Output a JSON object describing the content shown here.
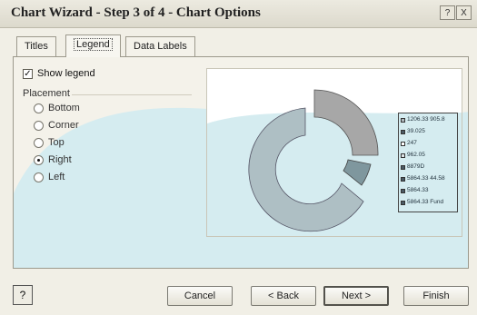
{
  "window": {
    "title": "Chart Wizard - Step 3 of 4 - Chart Options",
    "help_glyph": "?",
    "close_glyph": "X"
  },
  "tabs": [
    {
      "label": "Titles",
      "active": false
    },
    {
      "label": "Legend",
      "active": true
    },
    {
      "label": "Data Labels",
      "active": false
    }
  ],
  "legend_tab": {
    "show_legend_label": "Show legend",
    "show_legend_checked": true,
    "placement_label": "Placement",
    "placements": [
      {
        "label": "Bottom",
        "selected": false
      },
      {
        "label": "Corner",
        "selected": false
      },
      {
        "label": "Top",
        "selected": false
      },
      {
        "label": "Right",
        "selected": true
      },
      {
        "label": "Left",
        "selected": false
      }
    ]
  },
  "preview": {
    "legend_entries": [
      {
        "label": "1206.33 905.8",
        "swatch": "#aeb8bd"
      },
      {
        "label": "39.025",
        "swatch": "#4b5a64"
      },
      {
        "label": "247",
        "swatch": "#ffffff"
      },
      {
        "label": "962.05",
        "swatch": "#dde3e6"
      },
      {
        "label": "8879D",
        "swatch": "#4b5a64"
      },
      {
        "label": "5864.33 44.58",
        "swatch": "#4b5a64"
      },
      {
        "label": "5864.33",
        "swatch": "#4b5a64"
      },
      {
        "label": "5864.33 Fund",
        "swatch": "#4b5a64"
      }
    ]
  },
  "buttons": {
    "help": "?",
    "cancel": "Cancel",
    "back": "< Back",
    "next": "Next >",
    "finish": "Finish"
  },
  "colors": {
    "dialog_bg": "#f1efe6",
    "wave": "#d5ecf0",
    "ring": "#aebfc4",
    "slice_gray": "#a7a7a7",
    "slice_blue": "#7f979e"
  }
}
